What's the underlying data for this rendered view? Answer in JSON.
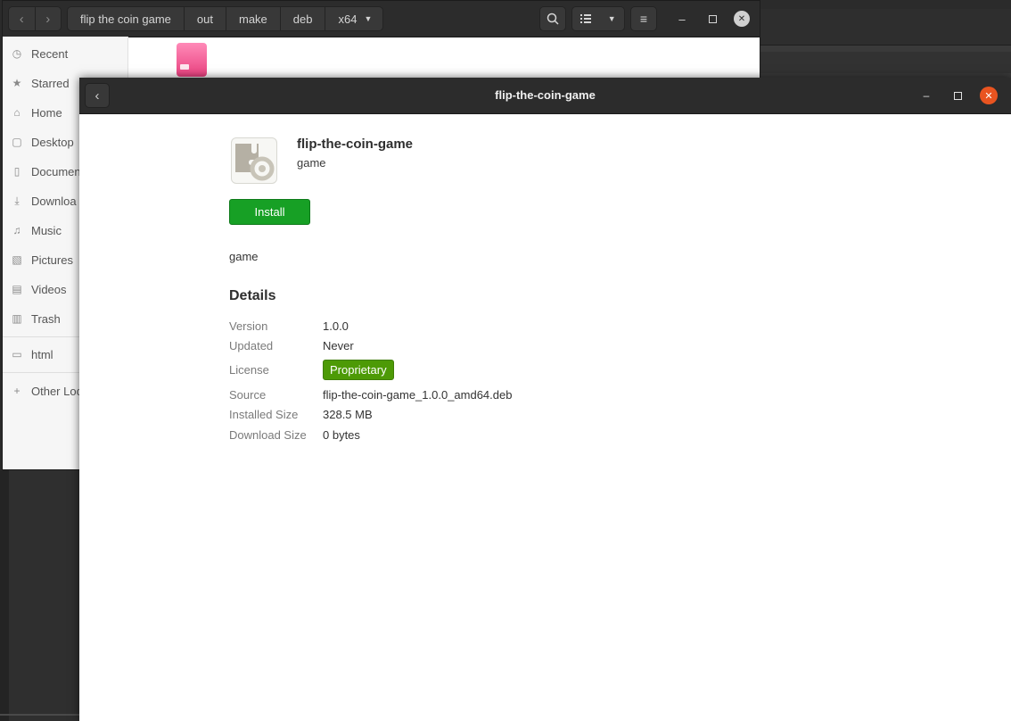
{
  "file_manager": {
    "breadcrumbs": [
      "flip the coin game",
      "out",
      "make",
      "deb",
      "x64"
    ],
    "sidebar": [
      {
        "label": "Recent",
        "icon": "recent-icon"
      },
      {
        "label": "Starred",
        "icon": "star-icon"
      },
      {
        "label": "Home",
        "icon": "home-icon"
      },
      {
        "label": "Desktop",
        "icon": "desktop-icon"
      },
      {
        "label": "Documen",
        "icon": "documents-icon"
      },
      {
        "label": "Downloa",
        "icon": "downloads-icon"
      },
      {
        "label": "Music",
        "icon": "music-icon"
      },
      {
        "label": "Pictures",
        "icon": "pictures-icon"
      },
      {
        "label": "Videos",
        "icon": "videos-icon"
      },
      {
        "label": "Trash",
        "icon": "trash-icon"
      },
      {
        "label": "html",
        "icon": "folder-icon"
      },
      {
        "label": "Other Loc",
        "icon": "plus-icon"
      }
    ]
  },
  "dialog": {
    "title": "flip-the-coin-game",
    "app_name": "flip-the-coin-game",
    "app_summary": "game",
    "install_label": "Install",
    "description": "game",
    "details_heading": "Details",
    "details": {
      "version": {
        "label": "Version",
        "value": "1.0.0"
      },
      "updated": {
        "label": "Updated",
        "value": "Never"
      },
      "license": {
        "label": "License",
        "value": "Proprietary"
      },
      "source": {
        "label": "Source",
        "value": "flip-the-coin-game_1.0.0_amd64.deb"
      },
      "installed_size": {
        "label": "Installed Size",
        "value": "328.5 MB"
      },
      "download_size": {
        "label": "Download Size",
        "value": "0 bytes"
      }
    }
  },
  "colors": {
    "install_button": "#17a025",
    "license_badge": "#4d9a06",
    "close_button": "#e95420",
    "header_bar": "#2c2c2c"
  }
}
